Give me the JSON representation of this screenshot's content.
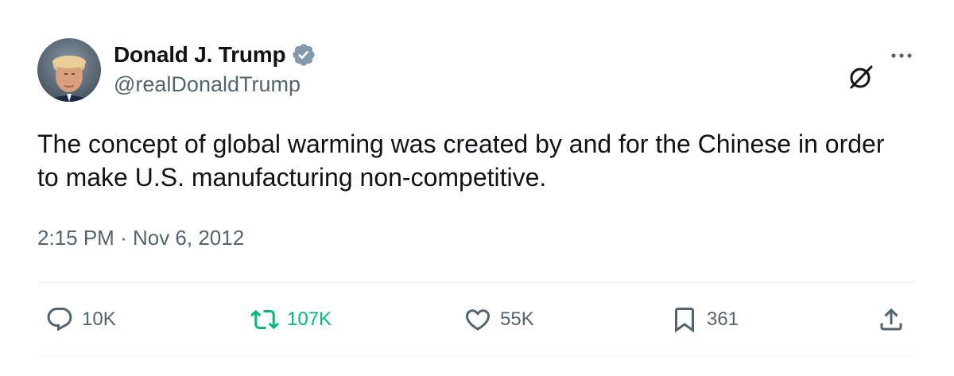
{
  "author": {
    "display_name": "Donald J. Trump",
    "handle": "@realDonaldTrump",
    "verified": true,
    "verified_color": "#829aab"
  },
  "icons": {
    "grok": "grok-icon",
    "more": "more-icon",
    "verified": "verified-badge-icon"
  },
  "tweet": {
    "text": "The concept of global warming was created by and for the Chinese in order to make U.S. manufacturing non-competitive.",
    "time": "2:15 PM",
    "separator": "·",
    "date": "Nov 6, 2012"
  },
  "actions": {
    "replies": "10K",
    "reposts": "107K",
    "likes": "55K",
    "bookmarks": "361",
    "repost_color": "#00ba7c"
  }
}
